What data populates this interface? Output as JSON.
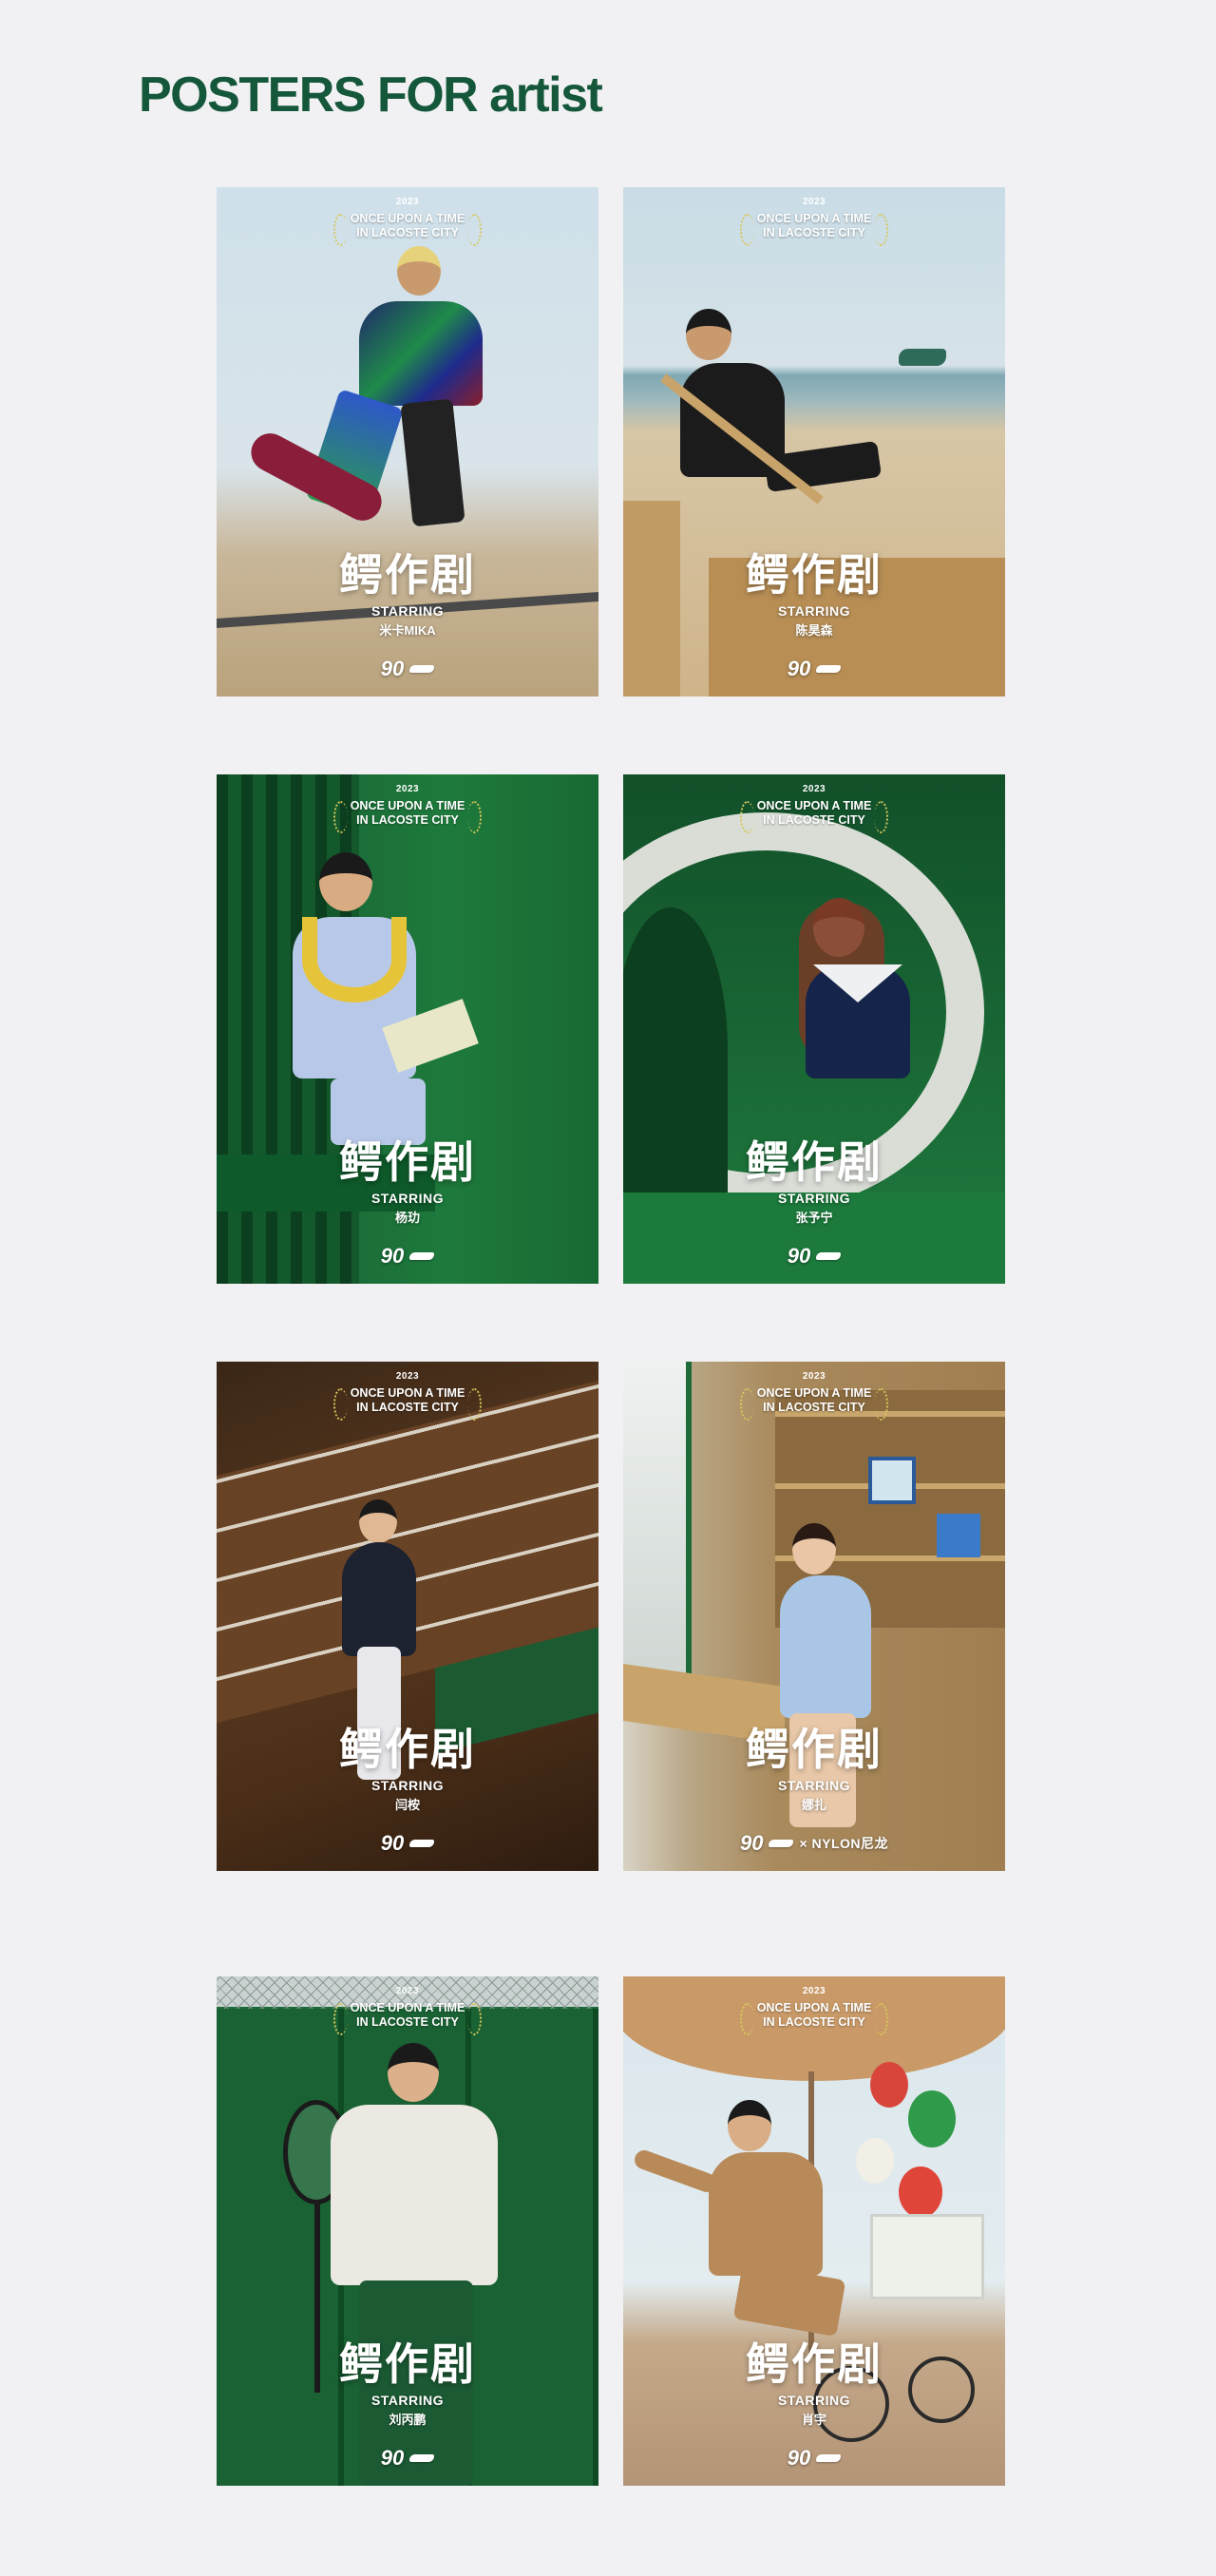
{
  "page": {
    "title": "POSTERS FOR artist"
  },
  "poster_common": {
    "year": "2023",
    "award_line1": "ONCE UPON A TIME",
    "award_line2": "IN LACOSTE CITY",
    "headline": "鳄作剧",
    "starring": "STARRING",
    "logo_number": "90"
  },
  "posters": [
    {
      "artist": "米卡MIKA",
      "collab": ""
    },
    {
      "artist": "陈昊森",
      "collab": ""
    },
    {
      "artist": "杨玏",
      "collab": ""
    },
    {
      "artist": "张予宁",
      "collab": ""
    },
    {
      "artist": "闫桉",
      "collab": ""
    },
    {
      "artist": "娜扎",
      "collab": "× NYLON尼龙"
    },
    {
      "artist": "刘丙鹏",
      "collab": ""
    },
    {
      "artist": "肖宇",
      "collab": ""
    }
  ],
  "colors": {
    "title": "#15573a",
    "page_bg": "#f1f1f3",
    "lacoste_green": "#1f6b3a",
    "laurel_gold": "#d8c75a"
  }
}
